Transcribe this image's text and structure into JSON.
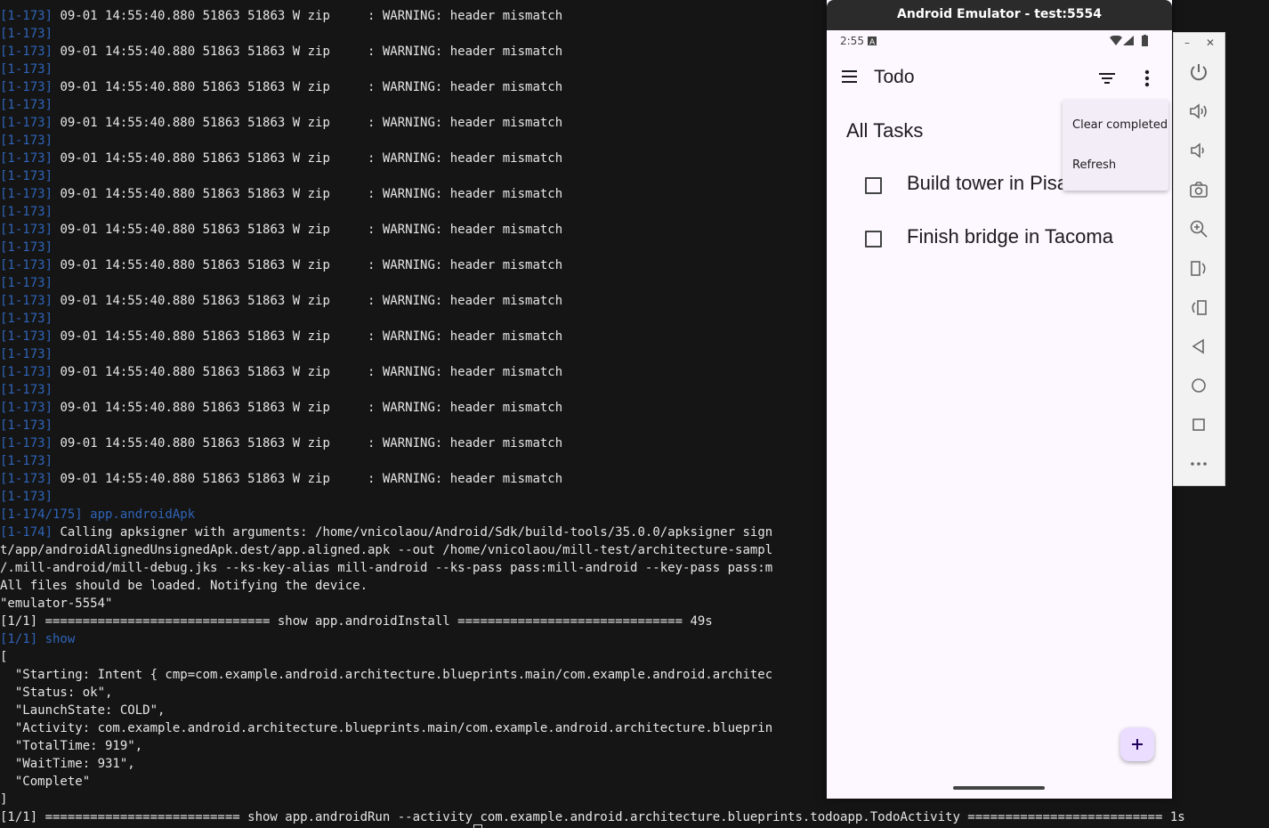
{
  "terminal": {
    "lines": [
      [
        {
          "c": "blue",
          "t": "[1-173]"
        },
        {
          "c": "white",
          "t": " 09-01 14:55:40.880 51863 51863 W zip     : WARNING: header mismatch"
        }
      ],
      [
        {
          "c": "blue",
          "t": "[1-173]"
        }
      ],
      [
        {
          "c": "blue",
          "t": "[1-173]"
        },
        {
          "c": "white",
          "t": " 09-01 14:55:40.880 51863 51863 W zip     : WARNING: header mismatch"
        }
      ],
      [
        {
          "c": "blue",
          "t": "[1-173]"
        }
      ],
      [
        {
          "c": "blue",
          "t": "[1-173]"
        },
        {
          "c": "white",
          "t": " 09-01 14:55:40.880 51863 51863 W zip     : WARNING: header mismatch"
        }
      ],
      [
        {
          "c": "blue",
          "t": "[1-173]"
        }
      ],
      [
        {
          "c": "blue",
          "t": "[1-173]"
        },
        {
          "c": "white",
          "t": " 09-01 14:55:40.880 51863 51863 W zip     : WARNING: header mismatch"
        }
      ],
      [
        {
          "c": "blue",
          "t": "[1-173]"
        }
      ],
      [
        {
          "c": "blue",
          "t": "[1-173]"
        },
        {
          "c": "white",
          "t": " 09-01 14:55:40.880 51863 51863 W zip     : WARNING: header mismatch"
        }
      ],
      [
        {
          "c": "blue",
          "t": "[1-173]"
        }
      ],
      [
        {
          "c": "blue",
          "t": "[1-173]"
        },
        {
          "c": "white",
          "t": " 09-01 14:55:40.880 51863 51863 W zip     : WARNING: header mismatch"
        }
      ],
      [
        {
          "c": "blue",
          "t": "[1-173]"
        }
      ],
      [
        {
          "c": "blue",
          "t": "[1-173]"
        },
        {
          "c": "white",
          "t": " 09-01 14:55:40.880 51863 51863 W zip     : WARNING: header mismatch"
        }
      ],
      [
        {
          "c": "blue",
          "t": "[1-173]"
        }
      ],
      [
        {
          "c": "blue",
          "t": "[1-173]"
        },
        {
          "c": "white",
          "t": " 09-01 14:55:40.880 51863 51863 W zip     : WARNING: header mismatch"
        }
      ],
      [
        {
          "c": "blue",
          "t": "[1-173]"
        }
      ],
      [
        {
          "c": "blue",
          "t": "[1-173]"
        },
        {
          "c": "white",
          "t": " 09-01 14:55:40.880 51863 51863 W zip     : WARNING: header mismatch"
        }
      ],
      [
        {
          "c": "blue",
          "t": "[1-173]"
        }
      ],
      [
        {
          "c": "blue",
          "t": "[1-173]"
        },
        {
          "c": "white",
          "t": " 09-01 14:55:40.880 51863 51863 W zip     : WARNING: header mismatch"
        }
      ],
      [
        {
          "c": "blue",
          "t": "[1-173]"
        }
      ],
      [
        {
          "c": "blue",
          "t": "[1-173]"
        },
        {
          "c": "white",
          "t": " 09-01 14:55:40.880 51863 51863 W zip     : WARNING: header mismatch"
        }
      ],
      [
        {
          "c": "blue",
          "t": "[1-173]"
        }
      ],
      [
        {
          "c": "blue",
          "t": "[1-173]"
        },
        {
          "c": "white",
          "t": " 09-01 14:55:40.880 51863 51863 W zip     : WARNING: header mismatch"
        }
      ],
      [
        {
          "c": "blue",
          "t": "[1-173]"
        }
      ],
      [
        {
          "c": "blue",
          "t": "[1-173]"
        },
        {
          "c": "white",
          "t": " 09-01 14:55:40.880 51863 51863 W zip     : WARNING: header mismatch"
        }
      ],
      [
        {
          "c": "blue",
          "t": "[1-173]"
        }
      ],
      [
        {
          "c": "blue",
          "t": "[1-173]"
        },
        {
          "c": "white",
          "t": " 09-01 14:55:40.880 51863 51863 W zip     : WARNING: header mismatch"
        }
      ],
      [
        {
          "c": "blue",
          "t": "[1-173]"
        }
      ],
      [
        {
          "c": "blue",
          "t": "[1-174/175] app.androidApk"
        }
      ],
      [
        {
          "c": "blue",
          "t": "[1-174]"
        },
        {
          "c": "white",
          "t": " Calling apksigner with arguments: /home/vnicolaou/Android/Sdk/build-tools/35.0.0/apksigner sign                               e-samples/ou"
        }
      ],
      [
        {
          "c": "white",
          "t": "t/app/androidAlignedUnsignedApk.dest/app.aligned.apk --out /home/vnicolaou/mill-test/architecture-sampl                               me/vnicolaou"
        }
      ],
      [
        {
          "c": "white",
          "t": "/.mill-android/mill-debug.jks --ks-key-alias mill-android --ks-pass pass:mill-android --key-pass pass:m"
        }
      ],
      [
        {
          "c": "white",
          "t": "All files should be loaded. Notifying the device."
        }
      ],
      [
        {
          "c": "white",
          "t": "\"emulator-5554\""
        }
      ],
      [
        {
          "c": "white",
          "t": "[1/1] ============================== show app.androidInstall ============================== 49s"
        }
      ],
      [
        {
          "c": "blue",
          "t": "[1/1] show"
        }
      ],
      [
        {
          "c": "white",
          "t": "["
        }
      ],
      [
        {
          "c": "white",
          "t": "  \"Starting: Intent { cmp=com.example.android.architecture.blueprints.main/com.example.android.architec"
        }
      ],
      [
        {
          "c": "white",
          "t": "  \"Status: ok\","
        }
      ],
      [
        {
          "c": "white",
          "t": "  \"LaunchState: COLD\","
        }
      ],
      [
        {
          "c": "white",
          "t": "  \"Activity: com.example.android.architecture.blueprints.main/com.example.android.architecture.blueprin"
        }
      ],
      [
        {
          "c": "white",
          "t": "  \"TotalTime: 919\","
        }
      ],
      [
        {
          "c": "white",
          "t": "  \"WaitTime: 931\","
        }
      ],
      [
        {
          "c": "white",
          "t": "  \"Complete\""
        }
      ],
      [
        {
          "c": "white",
          "t": "]"
        }
      ],
      [
        {
          "c": "white",
          "t": "[1/1] ========================== show app.androidRun --activity com.example.android.architecture.blueprints.todoapp.TodoActivity ========================== 1s"
        }
      ]
    ]
  },
  "emulator": {
    "title": "Android Emulator - test:5554",
    "status_time": "2:55",
    "app_title": "Todo",
    "section_title": "All Tasks",
    "tasks": [
      {
        "label": "Build tower in Pisa",
        "checked": false
      },
      {
        "label": "Finish bridge in Tacoma",
        "checked": false
      }
    ],
    "overflow_menu": {
      "clear_completed": "Clear completed",
      "refresh": "Refresh"
    },
    "colors": {
      "surface": "#fdf7ff",
      "fab": "#eaddff",
      "menu": "#f3edf7"
    }
  },
  "toolbar": {
    "minimize": "–",
    "close": "✕",
    "buttons": [
      "power-icon",
      "volume-up-icon",
      "volume-down-icon",
      "camera-icon",
      "zoom-icon",
      "rotate-left-icon",
      "rotate-right-icon",
      "back-icon",
      "home-icon",
      "overview-icon",
      "more-icon"
    ]
  }
}
